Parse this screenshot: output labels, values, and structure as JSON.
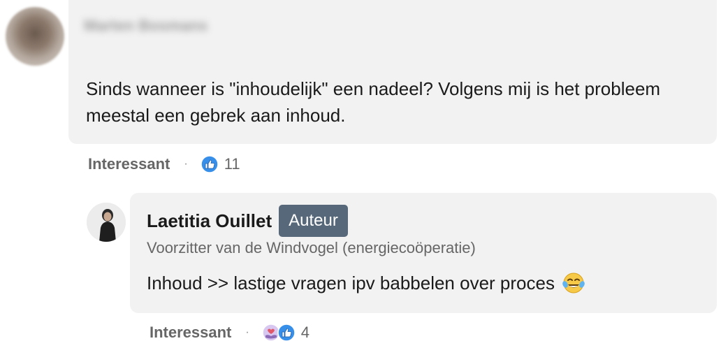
{
  "comment1": {
    "author_name_blurred": "Marten Bosmans",
    "text": "Sinds wanneer is \"inhoudelijk\" een nadeel? Volgens mij is het probleem meestal een gebrek aan inhoud.",
    "actions": {
      "reaction_label": "Interessant",
      "separator": "·",
      "reaction_icons": [
        "like-icon"
      ],
      "reaction_count": "11"
    }
  },
  "comment2": {
    "author_name": "Laetitia Ouillet",
    "badge": "Auteur",
    "author_title": "Voorzitter van de Windvogel (energiecoöperatie)",
    "text": "Inhoud >> lastige vragen ipv babbelen over proces",
    "emoji": "laughing-tears-emoji",
    "actions": {
      "reaction_label": "Interessant",
      "separator": "·",
      "reaction_icons": [
        "support-icon",
        "like-icon"
      ],
      "reaction_count": "4"
    }
  },
  "colors": {
    "bubble": "#f2f2f2",
    "badge": "#56687a",
    "like_blue": "#378fe9",
    "support_purple": "#d8c7f0"
  }
}
